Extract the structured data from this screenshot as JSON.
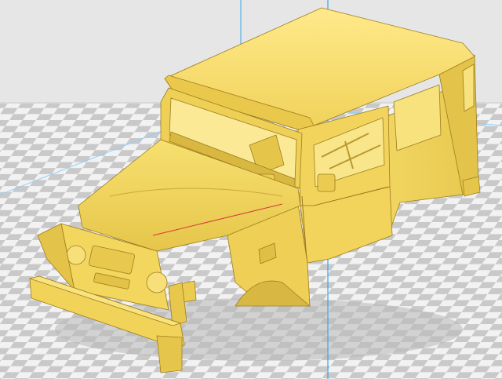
{
  "viewport": {
    "background_color": "#e6e6e6",
    "bed_light_color": "#f2f2f2",
    "bed_dark_color": "#c9c9c9",
    "bed_shadow_color": "#b8b8b8",
    "bed_edge_color": "#8fd0ff",
    "axis_color": "#3aa6e8",
    "model_color": "#f5dc6a",
    "model_shadow_color": "#c9a93a",
    "model_highlight_color": "#ffe98a",
    "model_edge_color": "#9c7d1f",
    "accent_line_color": "#d23a3a"
  },
  "model": {
    "name_icon": "jeep-body-3d-model",
    "grille_badge_icon": "emblem-icon"
  }
}
